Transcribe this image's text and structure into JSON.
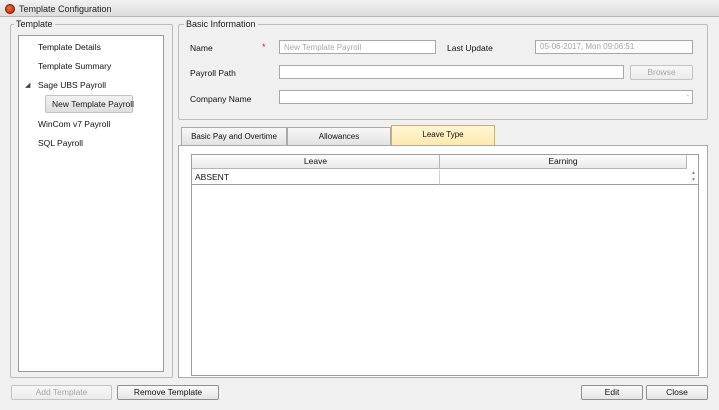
{
  "window": {
    "title": "Template Configuration"
  },
  "template_panel": {
    "label": "Template",
    "tree": [
      {
        "label": "Template Details"
      },
      {
        "label": "Template Summary"
      },
      {
        "label": "Sage UBS Payroll",
        "expander": "◢"
      },
      {
        "label": "New Template Payroll",
        "selected": true
      },
      {
        "label": "WinCom v7 Payroll"
      },
      {
        "label": "SQL Payroll"
      }
    ]
  },
  "basic_info": {
    "label": "Basic Information",
    "name_label": "Name",
    "required_marker": "*",
    "name_placeholder": "New Template Payroll",
    "last_update_label": "Last Update",
    "last_update_value": "05-06-2017, Mon  09:06:51",
    "payroll_path_label": "Payroll Path",
    "payroll_path_value": "",
    "browse_label": "Browse",
    "company_name_label": "Company Name",
    "company_name_value": "",
    "company_dropdown_icon": "-"
  },
  "tabs": [
    {
      "label": "Basic Pay and Overtime",
      "active": false
    },
    {
      "label": "Allowances",
      "active": false
    },
    {
      "label": "Leave Type",
      "active": true
    }
  ],
  "leave_grid": {
    "columns": [
      "Leave",
      "Earning"
    ],
    "rows": [
      {
        "leave": "ABSENT",
        "earning": ""
      }
    ]
  },
  "footer": {
    "add_template_label": "Add Template",
    "remove_template_label": "Remove Template",
    "edit_label": "Edit",
    "close_label": "Close"
  },
  "colors": {
    "active_tab": "#ffe9a8",
    "required_marker": "#d42020",
    "app_icon": "#d23a10"
  }
}
